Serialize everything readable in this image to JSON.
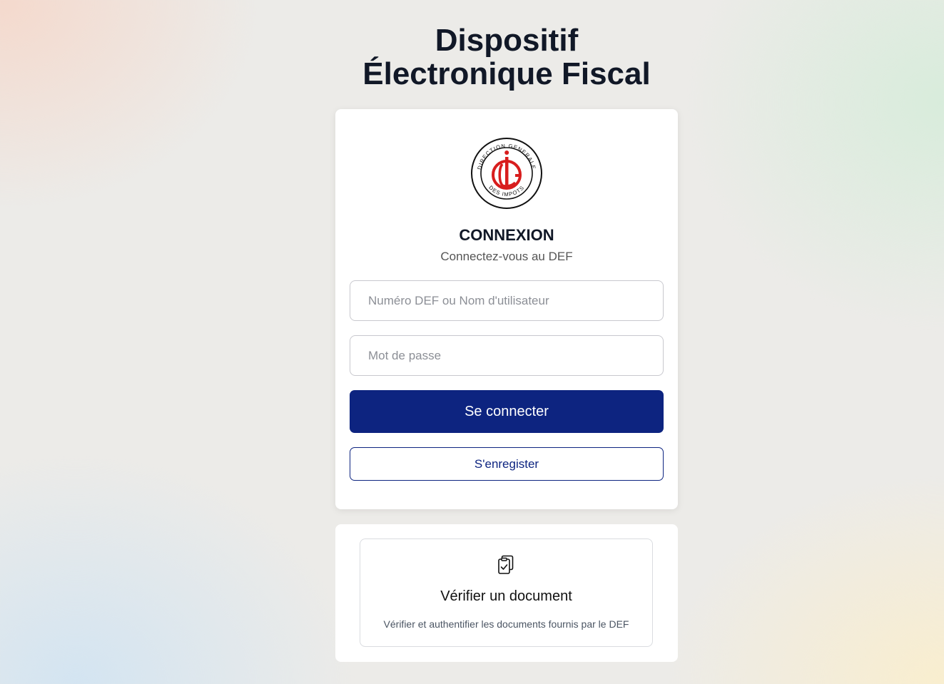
{
  "header": {
    "title_line1": "Dispositif",
    "title_line2": "Électronique Fiscal"
  },
  "login": {
    "logo_icon": "dgi-seal-icon",
    "logo_text_top": "DIRECTION GENERALE",
    "logo_text_bottom": "DES IMPOTS",
    "heading": "CONNEXION",
    "subtitle": "Connectez-vous au DEF",
    "username_placeholder": "Numéro DEF ou Nom d'utilisateur",
    "username_value": "",
    "password_placeholder": "Mot de passe",
    "password_value": "",
    "submit_label": "Se connecter",
    "register_label": "S'enregister"
  },
  "verify": {
    "icon": "clipboard-check-icon",
    "title": "Vérifier un document",
    "description": "Vérifier et authentifier les documents fournis par le DEF"
  },
  "colors": {
    "primary": "#0d2480",
    "logo_red": "#d81d1d"
  }
}
